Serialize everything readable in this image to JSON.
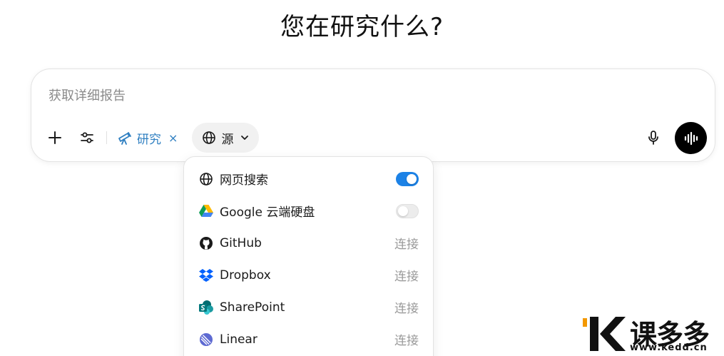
{
  "title": "您在研究什么?",
  "composer": {
    "placeholder": "获取详细报告",
    "research_label": "研究",
    "research_close": "×",
    "source_label": "源"
  },
  "sources": {
    "items": [
      {
        "name": "网页搜索",
        "icon": "globe-icon",
        "control": "toggle",
        "enabled": true
      },
      {
        "name": "Google 云端硬盘",
        "icon": "google-drive-icon",
        "control": "toggle",
        "enabled": false
      },
      {
        "name": "GitHub",
        "icon": "github-icon",
        "control": "connect",
        "action": "连接"
      },
      {
        "name": "Dropbox",
        "icon": "dropbox-icon",
        "control": "connect",
        "action": "连接"
      },
      {
        "name": "SharePoint",
        "icon": "sharepoint-icon",
        "control": "connect",
        "action": "连接"
      },
      {
        "name": "Linear",
        "icon": "linear-icon",
        "control": "connect",
        "action": "连接"
      }
    ]
  },
  "watermark": {
    "brand": "课多多",
    "url": "www.kedd.cn"
  },
  "colors": {
    "accent": "#1c82e6",
    "research": "#2f7fc1",
    "muted": "#9a9a9a"
  }
}
